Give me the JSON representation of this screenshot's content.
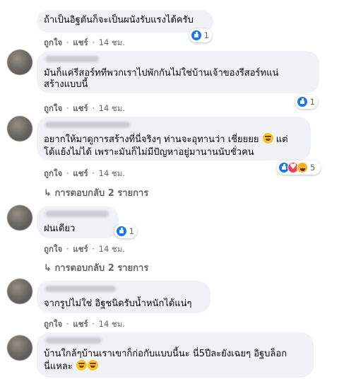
{
  "labels": {
    "like": "ถูกใจ",
    "dot": "·",
    "share": "แชร์",
    "time": "14 ชม."
  },
  "comments": [
    {
      "text": [
        "ถ้าเป็นอิฐตันก็จะเป็นผนังรับแรงได้ครับ"
      ],
      "reactions": [
        "like"
      ],
      "reaction_count": "1"
    },
    {
      "text": [
        "มันก็แค่รีสอร์ททีพวกเราไปพักกันไม่ใช่บ้านเจ้าของรีสอร์ทแน่",
        "สร้างแบบนี้"
      ],
      "reactions": [
        "like"
      ],
      "reaction_count": "1"
    },
    {
      "text": [
        "อยากให้มาดูการสร้างที่นี่จริงๆ ท่านจะอุทานว่า เชี่ยยยย",
        "โด้แย้งไม่ได้ เพราะมันก็ไม่มีปัญหาอยู่มานานนับชั่วคน"
      ],
      "text_suffix": "แต่",
      "reactions": [
        "like",
        "love",
        "haha"
      ],
      "reaction_count": "5",
      "replies_label": "การตอบกลับ 2 รายการ"
    },
    {
      "text": [
        "ฝนเดียว"
      ],
      "reactions": [
        "like"
      ],
      "reaction_count": "1",
      "replies_label": "การตอบกลับ 2 รายการ"
    },
    {
      "text": [
        "จากรูปไม่ใช่ อิฐชนิดรับน้ำหนักได้แน่ๆ"
      ]
    },
    {
      "text": [
        "บ้านใกล้ๆบ้านเราเขาก็ก่อกับแบบนี้นะ นี่5ปีละยังเฉยๆ อิฐบล็อก",
        "นี่แหละ"
      ]
    }
  ],
  "icons": {
    "reaction_like": "like-icon",
    "reaction_love": "love-icon",
    "reaction_haha": "haha-icon",
    "reply_arrow": "reply-arrow-icon",
    "emoji": "grinning-face-icon"
  },
  "colors": {
    "bubble": "#f0f2f5",
    "secondary_text": "#65676b",
    "like": "#1877f2"
  }
}
